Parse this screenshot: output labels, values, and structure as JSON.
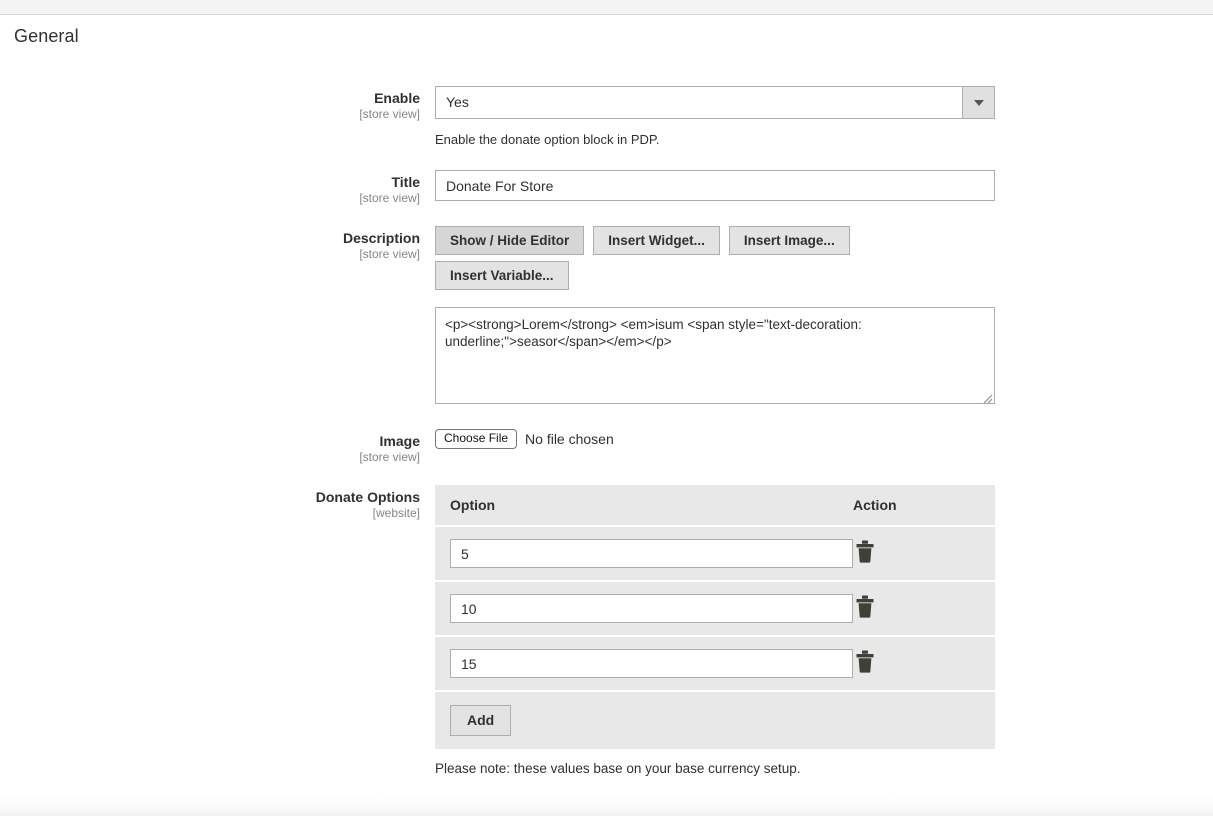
{
  "section": {
    "title": "General"
  },
  "fields": {
    "enable": {
      "label": "Enable",
      "scope": "[store view]",
      "value": "Yes",
      "hint": "Enable the donate option block in PDP."
    },
    "title": {
      "label": "Title",
      "scope": "[store view]",
      "value": "Donate For Store"
    },
    "description": {
      "label": "Description",
      "scope": "[store view]",
      "buttons": [
        "Show / Hide Editor",
        "Insert Widget...",
        "Insert Image...",
        "Insert Variable..."
      ],
      "value": "<p><strong>Lorem</strong> <em>isum <span style=\"text-decoration: underline;\">seasor</span></em></p>"
    },
    "image": {
      "label": "Image",
      "scope": "[store view]",
      "choose_label": "Choose File",
      "file_status": "No file chosen"
    },
    "donate_options": {
      "label": "Donate Options",
      "scope": "[website]",
      "columns": [
        "Option",
        "Action"
      ],
      "rows": [
        {
          "option": "5",
          "action_icon": "trash-icon"
        },
        {
          "option": "10",
          "action_icon": "trash-icon"
        },
        {
          "option": "15",
          "action_icon": "trash-icon"
        }
      ],
      "add_label": "Add",
      "note": "Please note: these values base on your base currency setup."
    }
  },
  "colors": {
    "page_bg": "#ffffff",
    "top_strip": "#f4f4f4",
    "table_bg": "#e8e8e8",
    "button_bg": "#e3e3e3",
    "border": "#adadad",
    "text": "#303030",
    "scope_text": "#858585"
  }
}
